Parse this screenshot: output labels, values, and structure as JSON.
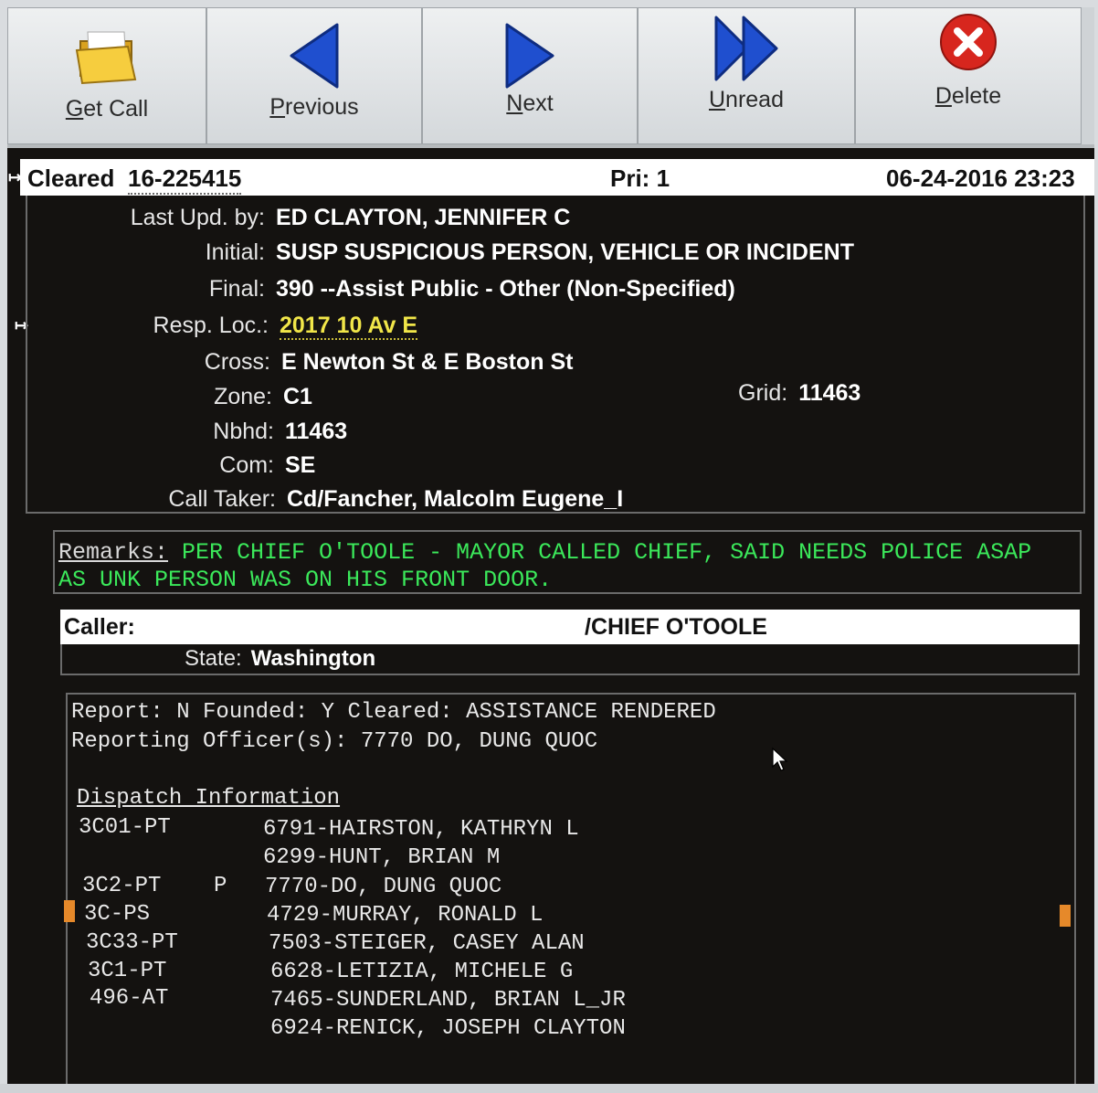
{
  "toolbar": {
    "get_call": "Get Call",
    "previous": "Previous",
    "next": "Next",
    "unread": "Unread",
    "delete": "Delete"
  },
  "header": {
    "status": "Cleared",
    "call_number": "16-225415",
    "priority": "Pri: 1",
    "datetime": "06-24-2016 23:23"
  },
  "details": {
    "last_upd_label": "Last Upd. by:",
    "last_upd": "ED CLAYTON, JENNIFER C",
    "initial_label": "Initial:",
    "initial": "SUSP SUSPICIOUS PERSON, VEHICLE OR INCIDENT",
    "final_label": "Final:",
    "final": "390 --Assist Public - Other (Non-Specified)",
    "resp_loc_label": "Resp. Loc.:",
    "resp_loc": "2017 10 Av E",
    "cross_label": "Cross:",
    "cross": "E Newton St & E Boston St",
    "zone_label": "Zone:",
    "zone": "C1",
    "grid_label": "Grid:",
    "grid": "11463",
    "nbhd_label": "Nbhd:",
    "nbhd": "11463",
    "com_label": "Com:",
    "com": "SE",
    "call_taker_label": "Call Taker:",
    "call_taker": "Cd/Fancher, Malcolm Eugene_I"
  },
  "remarks": {
    "label": "Remarks:",
    "line1": " PER CHIEF O'TOOLE - MAYOR CALLED CHIEF, SAID NEEDS POLICE ASAP",
    "line2": "AS UNK PERSON WAS ON HIS FRONT DOOR."
  },
  "caller": {
    "label": "Caller:",
    "name": "/CHIEF O'TOOLE",
    "state_label": "State:",
    "state": "Washington"
  },
  "report": {
    "line1": "Report: N Founded: Y Cleared: ASSISTANCE RENDERED",
    "line2": "Reporting Officer(s): 7770 DO, DUNG QUOC",
    "dispatch_heading": "Dispatch Information",
    "units": [
      {
        "unit": "3C01-PT",
        "flag": "",
        "officer": "6791-HAIRSTON, KATHRYN L"
      },
      {
        "unit": "",
        "flag": "",
        "officer": "6299-HUNT, BRIAN M"
      },
      {
        "unit": "3C2-PT",
        "flag": "P",
        "officer": "7770-DO, DUNG QUOC"
      },
      {
        "unit": "3C-PS",
        "flag": "",
        "officer": "4729-MURRAY, RONALD L"
      },
      {
        "unit": "3C33-PT",
        "flag": "",
        "officer": "7503-STEIGER, CASEY ALAN"
      },
      {
        "unit": "3C1-PT",
        "flag": "",
        "officer": "6628-LETIZIA, MICHELE G"
      },
      {
        "unit": "496-AT",
        "flag": "",
        "officer": "7465-SUNDERLAND, BRIAN L_JR"
      },
      {
        "unit": "",
        "flag": "",
        "officer": "6924-RENICK, JOSEPH CLAYTON"
      }
    ]
  },
  "colors": {
    "screen_bg": "#141210",
    "remarks_text": "#3be85a",
    "resp_loc_text": "#f1e649",
    "header_bg": "#ffffff"
  },
  "icons": [
    "folder-icon",
    "previous-arrow-icon",
    "next-arrow-icon",
    "unread-double-arrow-icon",
    "delete-x-icon",
    "mouse-pointer-icon"
  ]
}
